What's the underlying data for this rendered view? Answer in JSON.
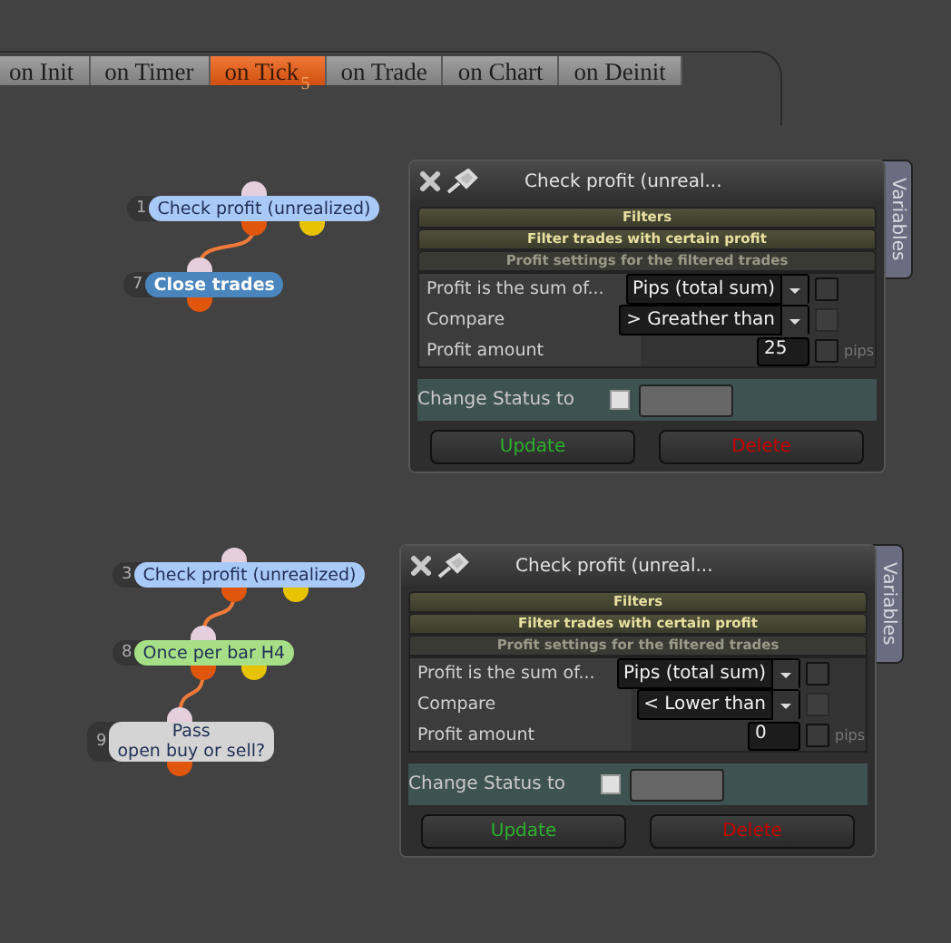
{
  "tabs": [
    {
      "label": "on Init",
      "selected": false
    },
    {
      "label": "on Timer",
      "selected": false
    },
    {
      "label": "on Tick",
      "selected": true,
      "badge": "5"
    },
    {
      "label": "on Trade",
      "selected": false
    },
    {
      "label": "on Chart",
      "selected": false
    },
    {
      "label": "on Deinit",
      "selected": false
    }
  ],
  "flows": [
    {
      "nodes": [
        {
          "number": "1",
          "label": "Check profit (unrealized)",
          "color": "#a9c9f7",
          "kind": "filter"
        },
        {
          "number": "7",
          "label": "Close trades",
          "color": "#4a86bd",
          "kind": "action"
        }
      ],
      "panel": {
        "title": "Check profit (unreal...",
        "side_tab": "Variables",
        "sections": [
          "Filters",
          "Filter trades with certain profit",
          "Profit settings for the filtered trades"
        ],
        "fields": [
          {
            "label": "Profit is the sum of...",
            "kind": "select",
            "value": "Pips (total sum)",
            "checked": false,
            "disabled": false
          },
          {
            "label": "Compare",
            "kind": "select",
            "value": "> Greather than",
            "checked": false,
            "disabled": true
          },
          {
            "label": "Profit amount",
            "kind": "number",
            "value": "25",
            "unit": "pips",
            "checked": false,
            "disabled": false
          }
        ],
        "status": {
          "label": "Change Status to",
          "checked": false
        },
        "buttons": [
          {
            "label": "Update",
            "kind": "update"
          },
          {
            "label": "Delete",
            "kind": "delete"
          }
        ]
      }
    },
    {
      "nodes": [
        {
          "number": "3",
          "label": "Check profit (unrealized)",
          "color": "#a9c9f7",
          "kind": "filter"
        },
        {
          "number": "8",
          "label": "Once per bar H4",
          "color": "#a6df86",
          "kind": "filter"
        },
        {
          "number": "9",
          "label": "Pass\nopen buy or sell?",
          "color": "#d4d4d4",
          "kind": "action"
        }
      ],
      "panel": {
        "title": "Check profit (unreal...",
        "side_tab": "Variables",
        "sections": [
          "Filters",
          "Filter trades with certain profit",
          "Profit settings for the filtered trades"
        ],
        "fields": [
          {
            "label": "Profit is the sum of...",
            "kind": "select",
            "value": "Pips (total sum)",
            "checked": false,
            "disabled": false
          },
          {
            "label": "Compare",
            "kind": "select",
            "value": "< Lower than",
            "checked": false,
            "disabled": true
          },
          {
            "label": "Profit amount",
            "kind": "number",
            "value": "0",
            "unit": "pips",
            "checked": false,
            "disabled": false
          }
        ],
        "status": {
          "label": "Change Status to",
          "checked": false
        },
        "buttons": [
          {
            "label": "Update",
            "kind": "update"
          },
          {
            "label": "Delete",
            "kind": "delete"
          }
        ]
      }
    }
  ]
}
